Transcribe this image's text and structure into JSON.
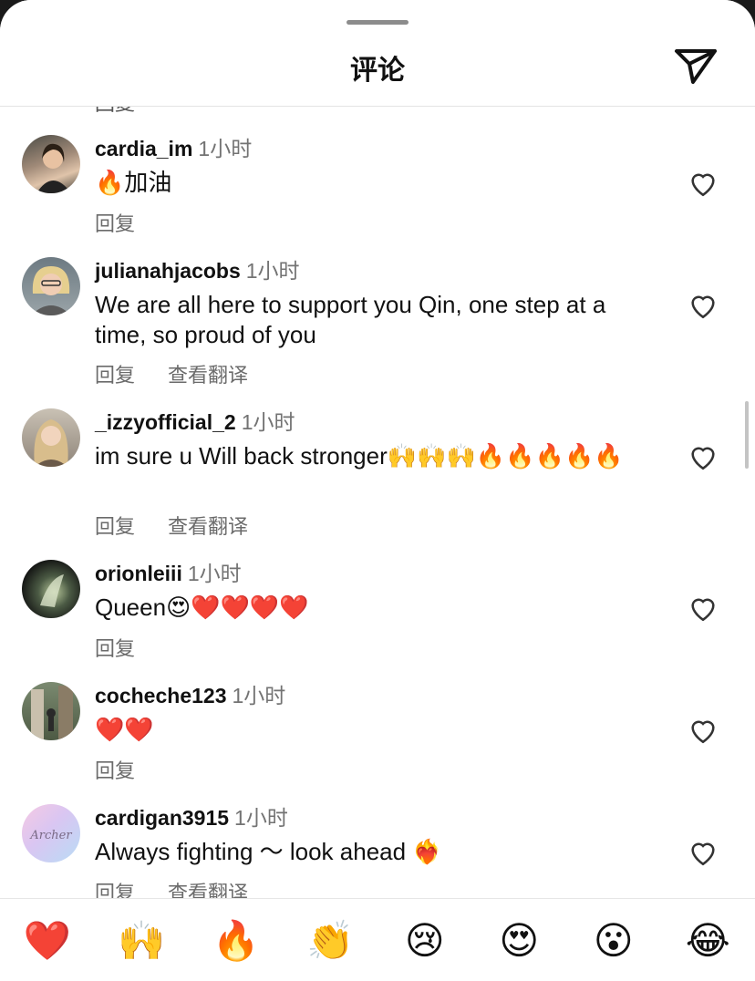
{
  "header": {
    "title": "评论"
  },
  "partial_top": {
    "reply_label": "回复"
  },
  "comments": [
    {
      "user": "cardia_im",
      "time": "1小时",
      "text": "🔥加油",
      "reply": "回复",
      "translate": ""
    },
    {
      "user": "julianahjacobs",
      "time": "1小时",
      "text": "We are all here to support you Qin, one step at a time, so proud of you",
      "reply": "回复",
      "translate": "查看翻译"
    },
    {
      "user": "_izzyofficial_2",
      "time": "1小时",
      "text": "im sure u Will back stronger🙌🙌🙌🔥🔥🔥🔥🔥",
      "reply": "回复",
      "translate": "查看翻译"
    },
    {
      "user": "orionleiii",
      "time": "1小时",
      "text": "Queen😍❤️❤️❤️❤️",
      "reply": "回复",
      "translate": ""
    },
    {
      "user": "cocheche123",
      "time": "1小时",
      "text": "❤️❤️",
      "reply": "回复",
      "translate": ""
    },
    {
      "user": "cardigan3915",
      "time": "1小时",
      "text": "Always fighting ～ look ahead ❤️‍🔥",
      "reply": "回复",
      "translate": "查看翻译"
    }
  ],
  "avatars": {
    "cardigan_text": "Archer"
  },
  "emoji_bar": [
    "❤️",
    "🙌",
    "🔥",
    "👏",
    "😢",
    "😍",
    "😮",
    "😂"
  ],
  "colors": {
    "text": "#111111",
    "secondary": "#737373",
    "divider": "#e4e4e4"
  }
}
